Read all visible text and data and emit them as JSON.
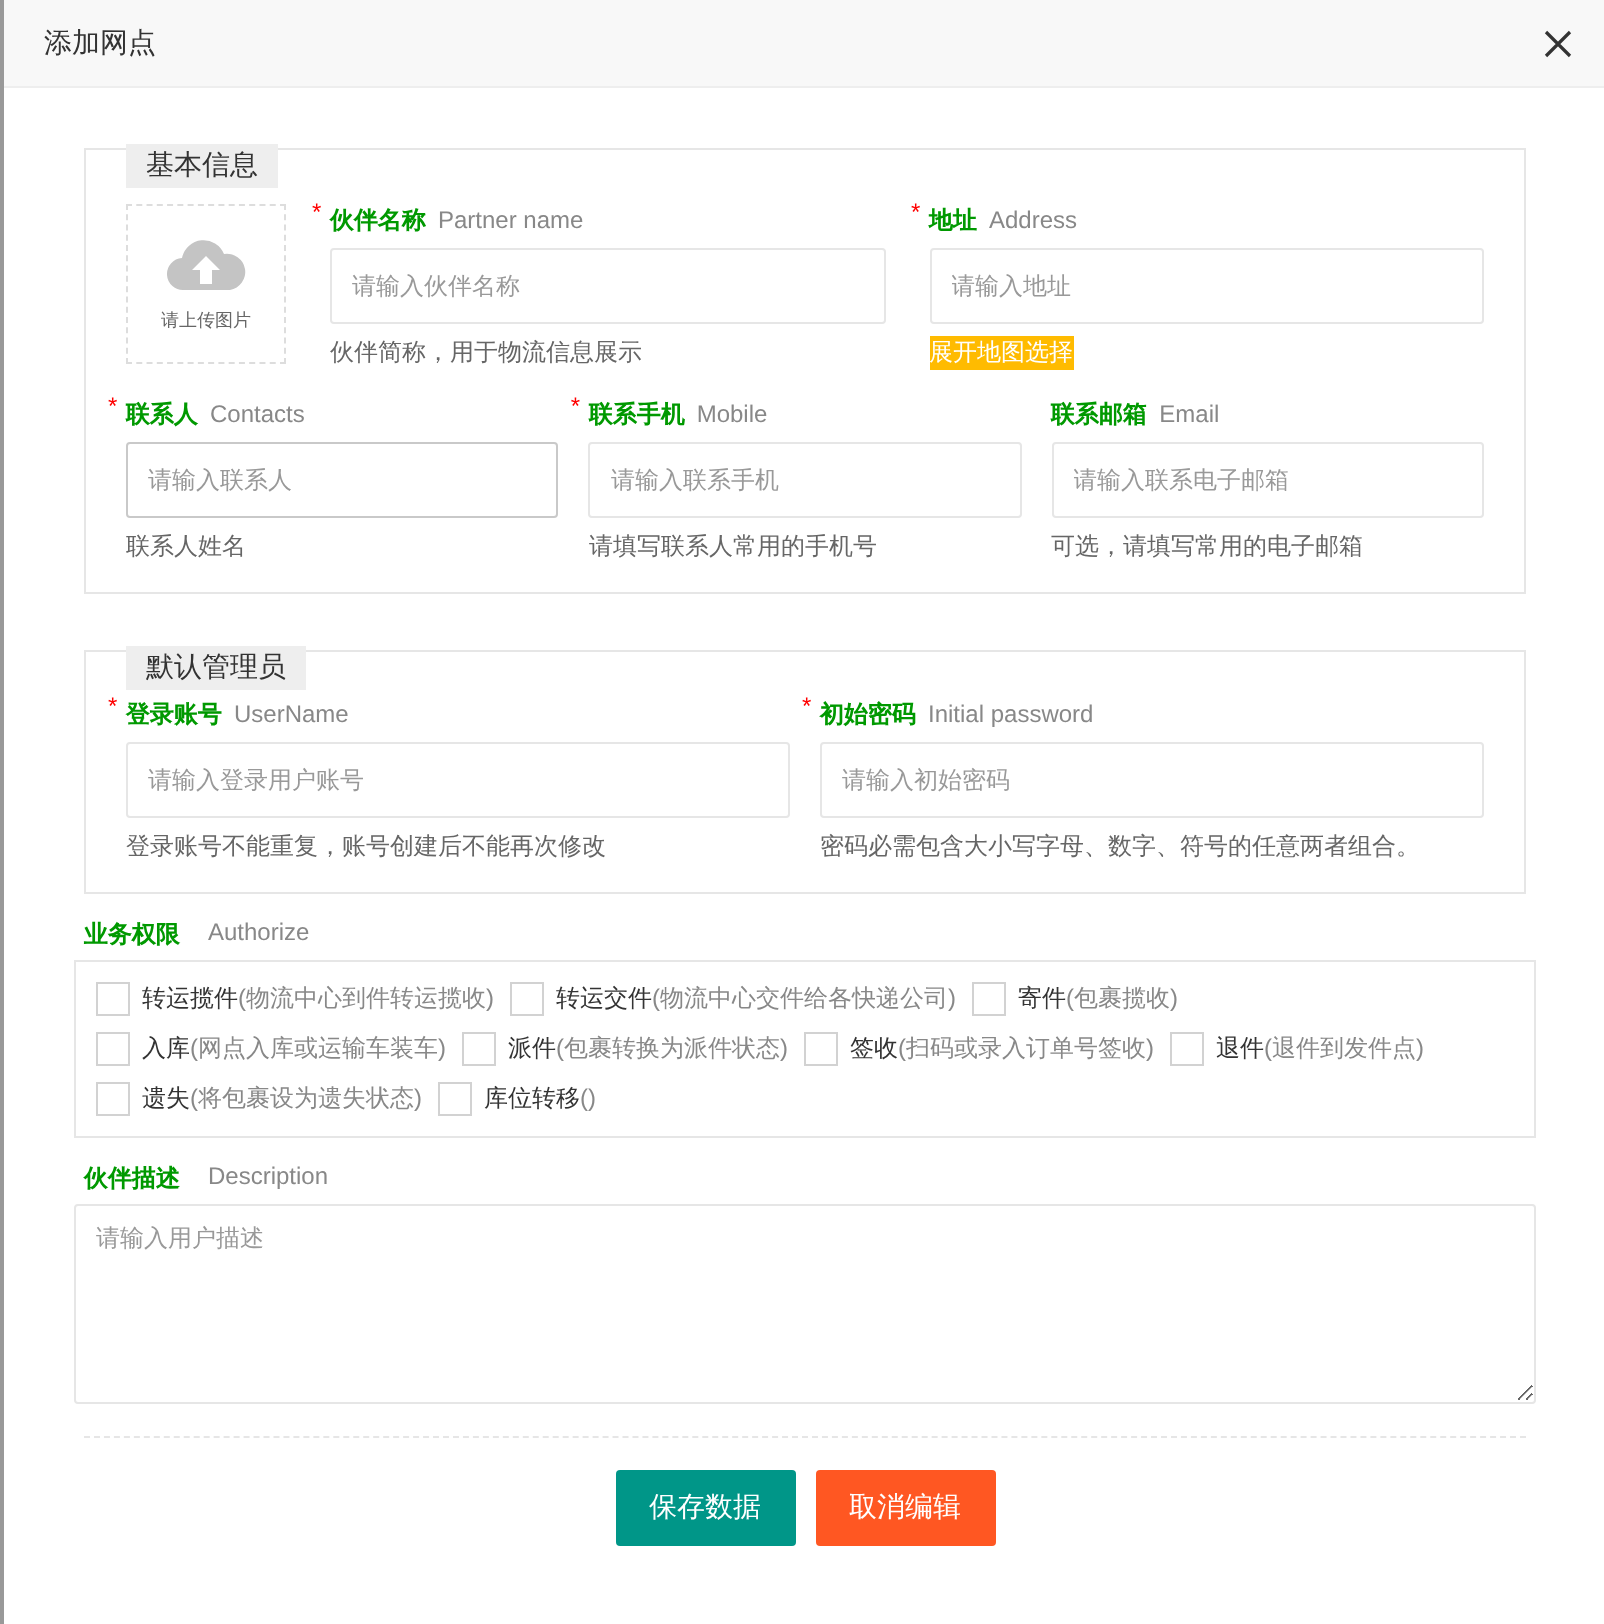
{
  "window": {
    "title": "添加网点"
  },
  "basic_info": {
    "legend": "基本信息",
    "upload": {
      "caption": "请上传图片"
    },
    "row_1": [
      {
        "required_mark": "*",
        "label": "伙伴名称",
        "label_en": "Partner name",
        "placeholder": "请输入伙伴名称",
        "help": "伙伴简称，用于物流信息展示",
        "focused": false
      },
      {
        "required_mark": "*",
        "label": "地址",
        "label_en": "Address",
        "placeholder": "请输入地址",
        "link": "展开地图选择",
        "focused": false
      }
    ],
    "row_2": [
      {
        "required_mark": "*",
        "label": "联系人",
        "label_en": "Contacts",
        "placeholder": "请输入联系人",
        "help": "联系人姓名",
        "focused": true
      },
      {
        "required_mark": "*",
        "label": "联系手机",
        "label_en": "Mobile",
        "placeholder": "请输入联系手机",
        "help": "请填写联系人常用的手机号",
        "focused": false
      },
      {
        "label": "联系邮箱",
        "label_en": "Email",
        "placeholder": "请输入联系电子邮箱",
        "help": "可选，请填写常用的电子邮箱",
        "focused": false
      }
    ]
  },
  "admin": {
    "legend": "默认管理员",
    "fields": [
      {
        "required_mark": "*",
        "label": "登录账号",
        "label_en": "UserName",
        "placeholder": "请输入登录用户账号",
        "help": "登录账号不能重复，账号创建后不能再次修改",
        "focused": false
      },
      {
        "required_mark": "*",
        "label": "初始密码",
        "label_en": "Initial password",
        "placeholder": "请输入初始密码",
        "help": "密码必需包含大小写字母、数字、符号的任意两者组合。",
        "focused": false
      }
    ]
  },
  "permissions": {
    "label": "业务权限",
    "label_en": "Authorize",
    "items": [
      {
        "name": "转运揽件",
        "note": "(物流中心到件转运揽收)",
        "checked": false
      },
      {
        "name": "转运交件",
        "note": "(物流中心交件给各快递公司)",
        "checked": false
      },
      {
        "name": "寄件",
        "note": "(包裹揽收)",
        "checked": false
      },
      {
        "name": "入库",
        "note": "(网点入库或运输车装车)",
        "checked": false
      },
      {
        "name": "派件",
        "note": "(包裹转换为派件状态)",
        "checked": false
      },
      {
        "name": "签收",
        "note": "(扫码或录入订单号签收)",
        "checked": false
      },
      {
        "name": "退件",
        "note": "(退件到发件点)",
        "checked": false
      },
      {
        "name": "遗失",
        "note": "(将包裹设为遗失状态)",
        "checked": false
      },
      {
        "name": "库位转移",
        "note": "()",
        "checked": false
      }
    ]
  },
  "description": {
    "label": "伙伴描述",
    "label_en": "Description",
    "placeholder": "请输入用户描述"
  },
  "buttons": [
    {
      "label": "保存数据",
      "kind": "primary"
    },
    {
      "label": "取消编辑",
      "kind": "danger"
    }
  ]
}
